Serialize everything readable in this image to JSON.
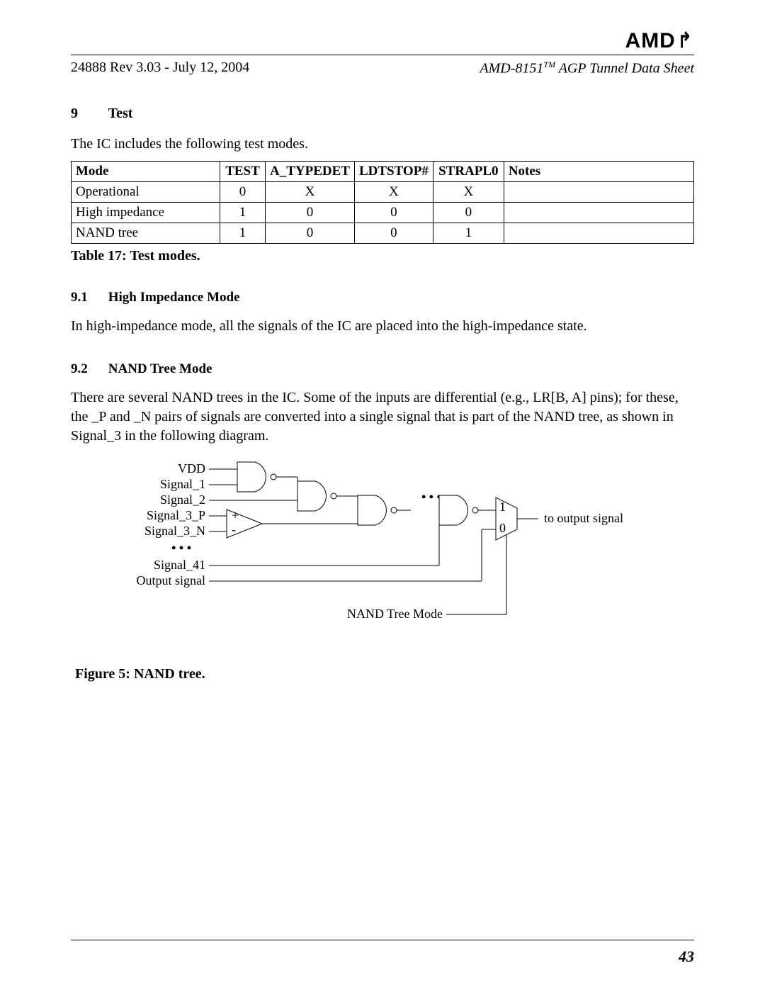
{
  "logo": {
    "text": "AMD",
    "arrow": "↗"
  },
  "header": {
    "left": "24888 Rev 3.03 - July 12, 2004",
    "right_prefix": "AMD-8151",
    "right_tm": "TM",
    "right_suffix": " AGP Tunnel Data Sheet"
  },
  "section": {
    "num": "9",
    "title": "Test"
  },
  "intro": "The IC includes the following test modes.",
  "table": {
    "headers": [
      "Mode",
      "TEST",
      "A_TYPEDET",
      "LDTSTOP#",
      "STRAPL0",
      "Notes"
    ],
    "rows": [
      {
        "mode": "Operational",
        "test": "0",
        "atype": "X",
        "ldt": "X",
        "strap": "X",
        "notes": ""
      },
      {
        "mode": "High impedance",
        "test": "1",
        "atype": "0",
        "ldt": "0",
        "strap": "0",
        "notes": ""
      },
      {
        "mode": "NAND tree",
        "test": "1",
        "atype": "0",
        "ldt": "0",
        "strap": "1",
        "notes": ""
      }
    ],
    "caption": "Table 17: Test modes."
  },
  "sub1": {
    "num": "9.1",
    "title": "High Impedance Mode",
    "body": "In high-impedance mode, all the signals of the IC are placed into the high-impedance state."
  },
  "sub2": {
    "num": "9.2",
    "title": "NAND Tree Mode",
    "body": "There are several NAND trees in the IC. Some of the inputs are differential (e.g., LR[B, A] pins); for these, the _P and _N pairs of signals are converted into a single signal that is part of the NAND tree, as shown in Signal_3 in the following diagram."
  },
  "diagram": {
    "labels": {
      "vdd": "VDD",
      "sig1": "Signal_1",
      "sig2": "Signal_2",
      "sig3p": "Signal_3_P",
      "sig3n": "Signal_3_N",
      "dots_left": "• • •",
      "sig41": "Signal_41",
      "outsig": "Output signal",
      "dots_mid": "• • •",
      "mux1": "1",
      "mux0": "0",
      "to_out": "to output signal",
      "nand_mode": "NAND Tree Mode"
    }
  },
  "figure_caption": "Figure 5: NAND tree.",
  "page_number": "43"
}
